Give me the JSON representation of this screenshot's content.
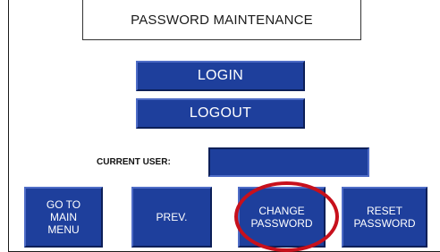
{
  "header": {
    "title": "PASSWORD MAINTENANCE"
  },
  "auth": {
    "login_label": "LOGIN",
    "logout_label": "LOGOUT"
  },
  "current_user": {
    "label": "CURRENT USER:",
    "value": ""
  },
  "nav": {
    "goto_main_menu_label": "GO TO\nMAIN\nMENU",
    "prev_label": "PREV.",
    "change_password_label": "CHANGE\nPASSWORD",
    "reset_password_label": "RESET\nPASSWORD"
  },
  "colors": {
    "button_blue": "#1e3f9c",
    "highlight_red": "#c7101c"
  }
}
